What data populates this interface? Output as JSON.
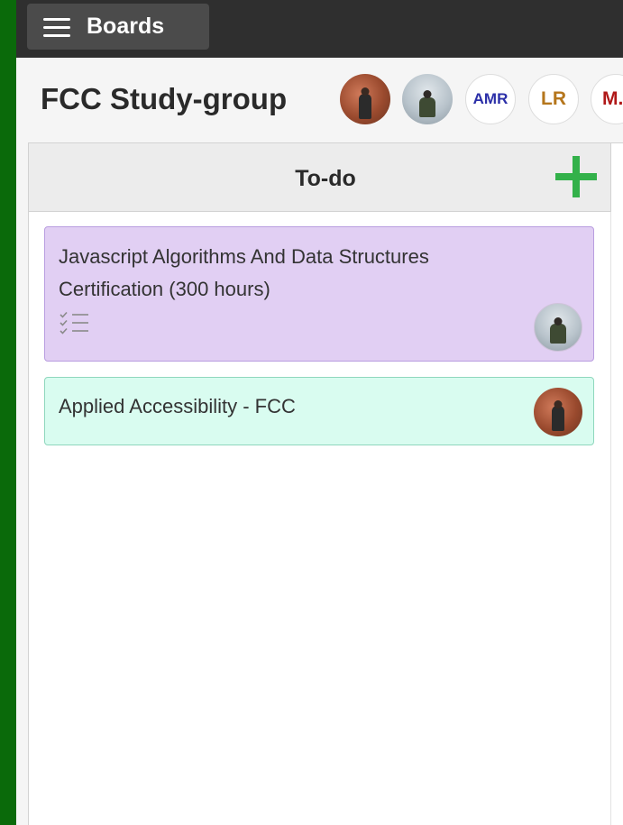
{
  "topbar": {
    "boards_label": "Boards",
    "menu_icon": "hamburger-menu-icon"
  },
  "board": {
    "title": "FCC Study-group",
    "members": [
      {
        "type": "photo",
        "icon": "avatar-photo"
      },
      {
        "type": "photo",
        "icon": "avatar-photo"
      },
      {
        "type": "initials",
        "initials": "AMR",
        "color": "#2b2fa8"
      },
      {
        "type": "initials",
        "initials": "LR",
        "color": "#b5761c"
      },
      {
        "type": "initials",
        "initials": "M.",
        "color": "#b01818"
      }
    ]
  },
  "list": {
    "title": "To-do",
    "add_icon": "plus-icon",
    "add_color": "#33b14a",
    "cards": [
      {
        "title": "Javascript Algorithms And Data Structures Certification (300 hours)",
        "color": "#e1cff3",
        "has_checklist": true,
        "checklist_icon": "checklist-icon"
      },
      {
        "title": "Applied Accessibility - FCC",
        "color": "#d9fcf0",
        "has_checklist": false
      }
    ]
  },
  "colors": {
    "page_background": "#0a6a0a",
    "topbar": "#2f2f2f"
  }
}
